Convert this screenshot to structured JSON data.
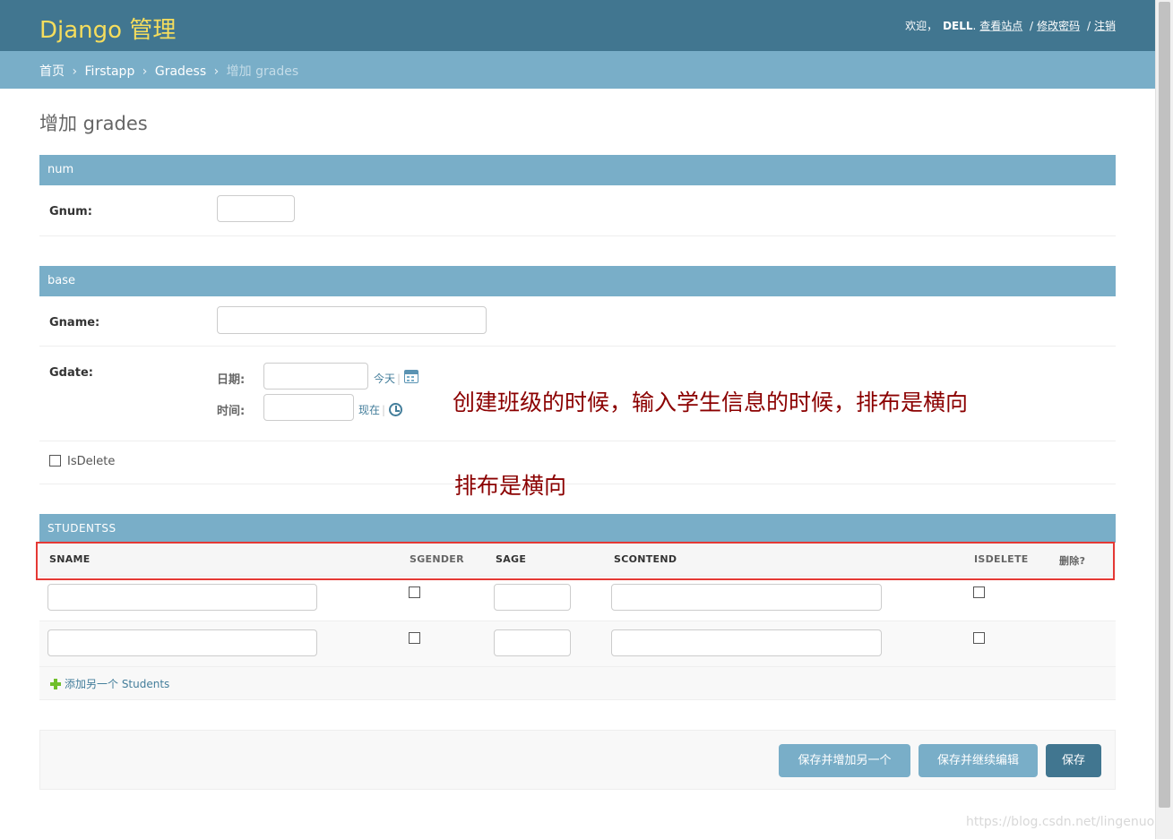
{
  "header": {
    "brand": "Django 管理",
    "welcome": "欢迎，",
    "username": "DELL",
    "username_suffix": ".",
    "view_site": "查看站点",
    "sep1": "/",
    "change_password": "修改密码",
    "sep2": "/",
    "logout": "注销"
  },
  "breadcrumbs": {
    "home": "首页",
    "app": "Firstapp",
    "model": "Gradess",
    "current": "增加 grades",
    "separator": "›"
  },
  "page_title": "增加 grades",
  "fieldsets": {
    "num": {
      "caption": "num",
      "gnum_label": "Gnum:",
      "gnum_value": ""
    },
    "base": {
      "caption": "base",
      "gname_label": "Gname:",
      "gname_value": "",
      "gdate_label": "Gdate:",
      "date_label": "日期:",
      "date_value": "",
      "today_link": "今天",
      "time_label": "时间:",
      "time_value": "",
      "now_link": "现在",
      "shortcut_sep": "|",
      "isdelete_label": "IsDelete",
      "isdelete_checked": false
    }
  },
  "annotations": {
    "main": "创建班级的时候，输入学生信息的时候，排布是横向",
    "secondary": "排布是横向"
  },
  "inline": {
    "caption": "STUDENTSS",
    "columns": [
      "SNAME",
      "SGENDER",
      "SAGE",
      "SCONTEND",
      "ISDELETE",
      "删除?"
    ],
    "rows": [
      {
        "sname": "",
        "sgender": false,
        "sage": "",
        "scontend": "",
        "isdelete": false
      },
      {
        "sname": "",
        "sgender": false,
        "sage": "",
        "scontend": "",
        "isdelete": false
      }
    ],
    "add_another": "添加另一个 Students"
  },
  "submit": {
    "save_add_another": "保存并增加另一个",
    "save_continue": "保存并继续编辑",
    "save": "保存"
  },
  "watermark": "https://blog.csdn.net/lingenuou",
  "colors": {
    "header": "#417690",
    "brand": "#f5dd5d",
    "breadcrumb_bar": "#79aec8",
    "caption": "#79aec8",
    "button_primary": "#417690",
    "button_secondary": "#79aec8",
    "annotation": "#8b0000",
    "highlight_box": "#e53935",
    "add_icon": "#70bf2b"
  }
}
